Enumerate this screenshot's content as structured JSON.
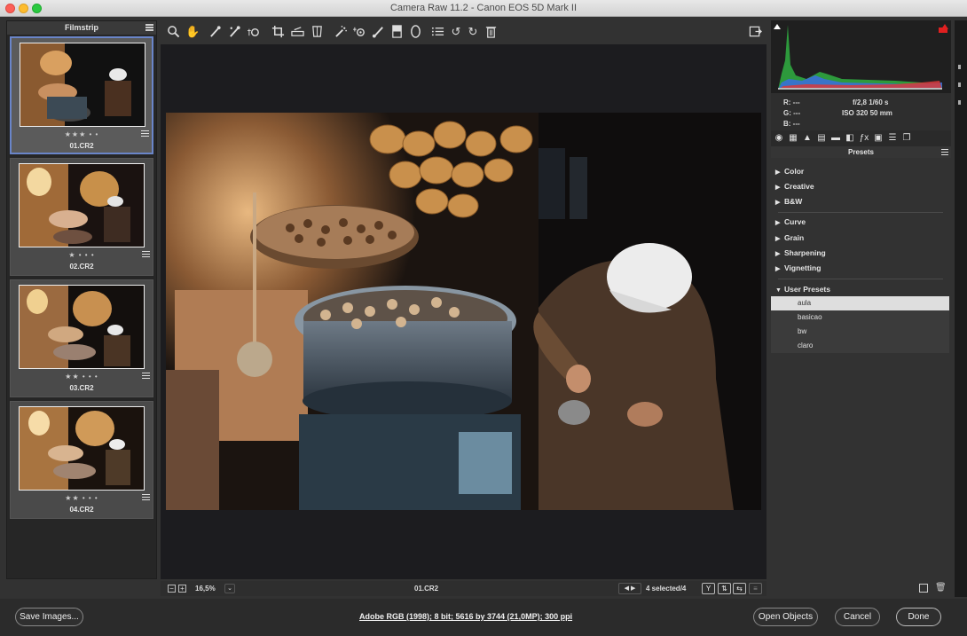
{
  "window": {
    "title": "Camera Raw 11.2  -  Canon EOS 5D Mark II"
  },
  "filmstrip": {
    "header": "Filmstrip",
    "items": [
      {
        "name": "01.CR2",
        "rating": "★★★ • •",
        "selected": true
      },
      {
        "name": "02.CR2",
        "rating": "★ • • •",
        "selected": false
      },
      {
        "name": "03.CR2",
        "rating": "★★ • • •",
        "selected": false
      },
      {
        "name": "04.CR2",
        "rating": "★★ • • •",
        "selected": false
      }
    ]
  },
  "toolbar": {
    "tools": [
      "zoom-tool",
      "hand-tool",
      "white-balance-tool",
      "color-sampler-tool",
      "targeted-adjustment-tool",
      "crop-tool",
      "straighten-tool",
      "transform-tool",
      "spot-removal-tool",
      "red-eye-tool",
      "adjustment-brush",
      "graduated-filter",
      "radial-filter",
      "preferences",
      "rotate-ccw",
      "rotate-cw",
      "trash"
    ]
  },
  "status": {
    "zoom": "16,5%",
    "file_name": "01.CR2",
    "selected": "4 selected/4"
  },
  "info": {
    "r": "R:   ---",
    "g": "G:   ---",
    "b": "B:   ---",
    "aperture_shutter": "f/2,8    1/60 s",
    "iso_focal": "ISO 320    50 mm"
  },
  "presets": {
    "header": "Presets",
    "groups_a": [
      "Color",
      "Creative",
      "B&W"
    ],
    "groups_b": [
      "Curve",
      "Grain",
      "Sharpening",
      "Vignetting"
    ],
    "user_presets_label": "User Presets",
    "user_presets": [
      "aula",
      "basicao",
      "bw",
      "claro"
    ]
  },
  "bottom": {
    "save_images": "Save Images...",
    "workflow_options": "Adobe RGB (1998); 8 bit; 5616 by 3744 (21,0MP); 300 ppi",
    "open_objects": "Open Objects",
    "cancel": "Cancel",
    "done": "Done"
  },
  "colors": {
    "accent_selection": "#6a85c9",
    "clipping_red": "#e02020"
  }
}
